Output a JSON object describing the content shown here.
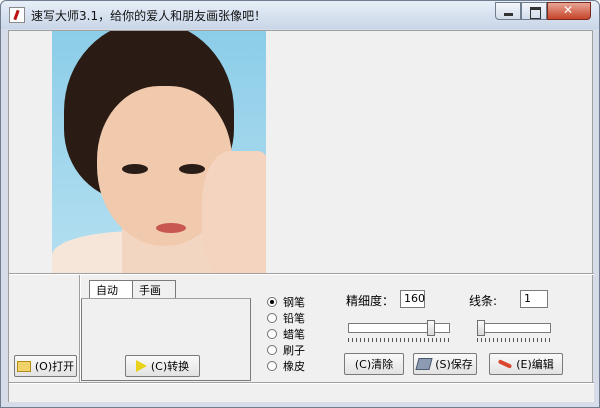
{
  "window": {
    "title": "速写大师3.1，给你的爱人和朋友画张像吧！"
  },
  "buttons": {
    "open": "(O)打开",
    "convert": "(C)转换",
    "clear": "(C)清除",
    "save": "(S)保存",
    "edit": "(E)编辑"
  },
  "tabs": [
    {
      "label": "自动",
      "selected": true
    },
    {
      "label": "手画",
      "selected": false
    }
  ],
  "tools": [
    {
      "label": "钢笔",
      "selected": true
    },
    {
      "label": "铅笔",
      "selected": false
    },
    {
      "label": "蜡笔",
      "selected": false
    },
    {
      "label": "刷子",
      "selected": false
    },
    {
      "label": "橡皮",
      "selected": false
    }
  ],
  "fineness": {
    "label": "精细度：",
    "value": "160",
    "slider_fraction": 0.84
  },
  "lines": {
    "label": "线条:",
    "value": "1",
    "slider_fraction": 0.0
  },
  "icons": {
    "open": "folder-icon",
    "convert": "play-icon",
    "save": "disk-icon",
    "edit": "pencil-icon"
  }
}
